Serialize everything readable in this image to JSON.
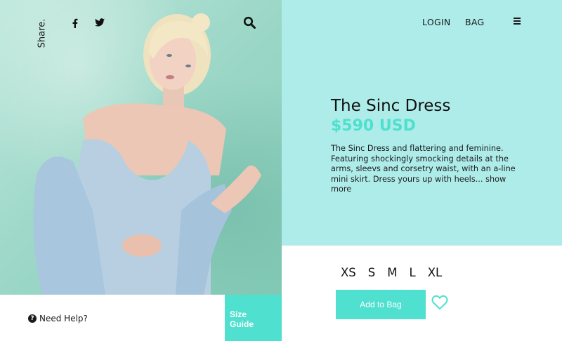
{
  "share": {
    "label": "Share."
  },
  "icons": {
    "facebook": "facebook-icon",
    "twitter": "twitter-icon",
    "search": "search-icon",
    "menu": "hamburger-menu-icon",
    "heart": "heart-icon",
    "help": "question-circle-icon"
  },
  "nav": {
    "login_label": "LOGIN",
    "bag_label": "BAG"
  },
  "product": {
    "title": "The Sinc Dress",
    "price": "$590 USD",
    "description": "The Sinc Dress and flattering and feminine. Featuring shockingly smocking details at the arms, sleevs and corsetry waist, with an a-line mini skirt. Dress yours up with heels...",
    "show_more": "show more"
  },
  "sizes": [
    "XS",
    "S",
    "M",
    "L",
    "XL"
  ],
  "actions": {
    "add_to_bag": "Add to Bag",
    "need_help": "Need Help?",
    "size_guide": "Size Guide"
  },
  "colors": {
    "accent": "#4fe0cf",
    "price": "#4ee0cf",
    "panel_bg": "#aeecea",
    "photo_bg": "#9ed8c8"
  }
}
